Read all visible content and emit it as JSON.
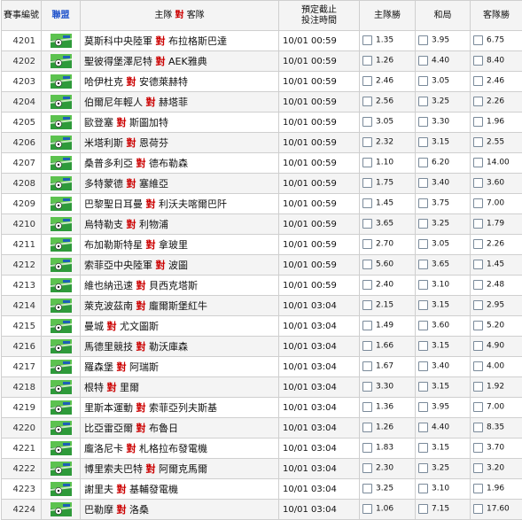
{
  "header": {
    "id": "賽事編號",
    "league": "聯盟",
    "home": "主隊",
    "vs": "對",
    "away": "客隊",
    "time_line1": "預定截止",
    "time_line2": "投注時間",
    "home_win": "主隊勝",
    "draw": "和局",
    "away_win": "客隊勝"
  },
  "colors": {
    "vs": "#cc0000",
    "header_league": "#2255cc",
    "row_alt": "#f4f4f4",
    "border": "#cfcfcf"
  },
  "league_icon": "soccer-ball-field-icon",
  "vs_word": "對",
  "rows": [
    {
      "id": "4201",
      "home": "莫斯科中央陸軍",
      "away": "布拉格斯巴達",
      "time": "10/01 00:59",
      "h": "1.35",
      "d": "3.95",
      "a": "6.75"
    },
    {
      "id": "4202",
      "home": "聖彼得堡澤尼特",
      "away": "AEK雅典",
      "time": "10/01 00:59",
      "h": "1.26",
      "d": "4.40",
      "a": "8.40"
    },
    {
      "id": "4203",
      "home": "哈伊杜克",
      "away": "安德萊赫特",
      "time": "10/01 00:59",
      "h": "2.46",
      "d": "3.05",
      "a": "2.46"
    },
    {
      "id": "4204",
      "home": "伯爾尼年輕人",
      "away": "赫塔菲",
      "time": "10/01 00:59",
      "h": "2.56",
      "d": "3.25",
      "a": "2.26"
    },
    {
      "id": "4205",
      "home": "歐登塞",
      "away": "斯圖加特",
      "time": "10/01 00:59",
      "h": "3.05",
      "d": "3.30",
      "a": "1.96"
    },
    {
      "id": "4206",
      "home": "米塔利斯",
      "away": "恩荷芬",
      "time": "10/01 00:59",
      "h": "2.32",
      "d": "3.15",
      "a": "2.55"
    },
    {
      "id": "4207",
      "home": "桑普多利亞",
      "away": "德布勒森",
      "time": "10/01 00:59",
      "h": "1.10",
      "d": "6.20",
      "a": "14.00"
    },
    {
      "id": "4208",
      "home": "多特蒙德",
      "away": "塞維亞",
      "time": "10/01 00:59",
      "h": "1.75",
      "d": "3.40",
      "a": "3.60"
    },
    {
      "id": "4209",
      "home": "巴黎聖日耳曼",
      "away": "利沃夫喀爾巴阡",
      "time": "10/01 00:59",
      "h": "1.45",
      "d": "3.75",
      "a": "7.00"
    },
    {
      "id": "4210",
      "home": "烏特勒支",
      "away": "利物浦",
      "time": "10/01 00:59",
      "h": "3.65",
      "d": "3.25",
      "a": "1.79"
    },
    {
      "id": "4211",
      "home": "布加勒斯特星",
      "away": "拿玻里",
      "time": "10/01 00:59",
      "h": "2.70",
      "d": "3.05",
      "a": "2.26"
    },
    {
      "id": "4212",
      "home": "索菲亞中央陸軍",
      "away": "波圖",
      "time": "10/01 00:59",
      "h": "5.60",
      "d": "3.65",
      "a": "1.45"
    },
    {
      "id": "4213",
      "home": "維也納迅速",
      "away": "貝西克塔斯",
      "time": "10/01 00:59",
      "h": "2.40",
      "d": "3.10",
      "a": "2.48"
    },
    {
      "id": "4214",
      "home": "萊克波茲南",
      "away": "龐爾斯堡紅牛",
      "time": "10/01 03:04",
      "h": "2.15",
      "d": "3.15",
      "a": "2.95"
    },
    {
      "id": "4215",
      "home": "曼城",
      "away": "尤文圖斯",
      "time": "10/01 03:04",
      "h": "1.49",
      "d": "3.60",
      "a": "5.20"
    },
    {
      "id": "4216",
      "home": "馬德里競技",
      "away": "勒沃庫森",
      "time": "10/01 03:04",
      "h": "1.66",
      "d": "3.15",
      "a": "4.90"
    },
    {
      "id": "4217",
      "home": "羅森堡",
      "away": "阿瑞斯",
      "time": "10/01 03:04",
      "h": "1.67",
      "d": "3.40",
      "a": "4.00"
    },
    {
      "id": "4218",
      "home": "根特",
      "away": "里爾",
      "time": "10/01 03:04",
      "h": "3.30",
      "d": "3.15",
      "a": "1.92"
    },
    {
      "id": "4219",
      "home": "里斯本運動",
      "away": "索菲亞列夫斯基",
      "time": "10/01 03:04",
      "h": "1.36",
      "d": "3.95",
      "a": "7.00"
    },
    {
      "id": "4220",
      "home": "比亞雷亞爾",
      "away": "布魯日",
      "time": "10/01 03:04",
      "h": "1.26",
      "d": "4.40",
      "a": "8.35"
    },
    {
      "id": "4221",
      "home": "龐洛尼卡",
      "away": "札格拉布發電機",
      "time": "10/01 03:04",
      "h": "1.83",
      "d": "3.15",
      "a": "3.70"
    },
    {
      "id": "4222",
      "home": "博里索夫巴特",
      "away": "阿爾克馬爾",
      "time": "10/01 03:04",
      "h": "2.30",
      "d": "3.25",
      "a": "3.20"
    },
    {
      "id": "4223",
      "home": "謝里夫",
      "away": "基輔發電機",
      "time": "10/01 03:04",
      "h": "3.25",
      "d": "3.10",
      "a": "1.96"
    },
    {
      "id": "4224",
      "home": "巴勒摩",
      "away": "洛桑",
      "time": "10/01 03:04",
      "h": "1.06",
      "d": "7.15",
      "a": "17.60"
    }
  ]
}
